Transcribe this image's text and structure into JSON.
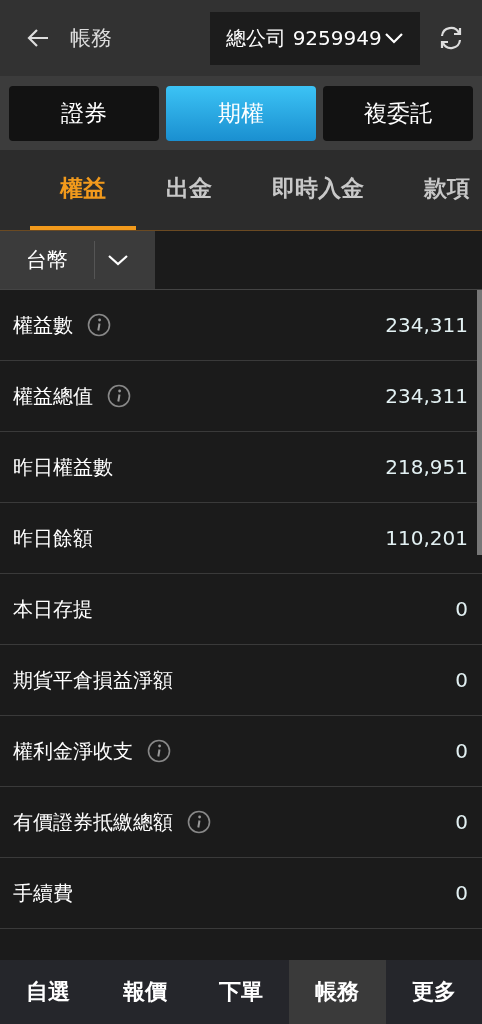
{
  "header": {
    "title": "帳務",
    "account": "總公司 9259949"
  },
  "segments": [
    {
      "label": "證券",
      "selected": false
    },
    {
      "label": "期權",
      "selected": true
    },
    {
      "label": "複委託",
      "selected": false
    }
  ],
  "tabs": [
    {
      "label": "權益",
      "selected": true
    },
    {
      "label": "出金",
      "selected": false
    },
    {
      "label": "即時入金",
      "selected": false
    },
    {
      "label": "款項",
      "selected": false
    }
  ],
  "currency": {
    "value": "台幣"
  },
  "rows": [
    {
      "label": "權益數",
      "info": true,
      "value": "234,311"
    },
    {
      "label": "權益總值",
      "info": true,
      "value": "234,311"
    },
    {
      "label": "昨日權益數",
      "info": false,
      "value": "218,951"
    },
    {
      "label": "昨日餘額",
      "info": false,
      "value": "110,201"
    },
    {
      "label": "本日存提",
      "info": false,
      "value": "0"
    },
    {
      "label": "期貨平倉損益淨額",
      "info": false,
      "value": "0"
    },
    {
      "label": "權利金淨收支",
      "info": true,
      "value": "0"
    },
    {
      "label": "有價證券抵繳總額",
      "info": true,
      "value": "0"
    },
    {
      "label": "手續費",
      "info": false,
      "value": "0"
    }
  ],
  "bottom_nav": [
    {
      "label": "自選",
      "selected": false
    },
    {
      "label": "報價",
      "selected": false
    },
    {
      "label": "下單",
      "selected": false
    },
    {
      "label": "帳務",
      "selected": true
    },
    {
      "label": "更多",
      "selected": false
    }
  ]
}
